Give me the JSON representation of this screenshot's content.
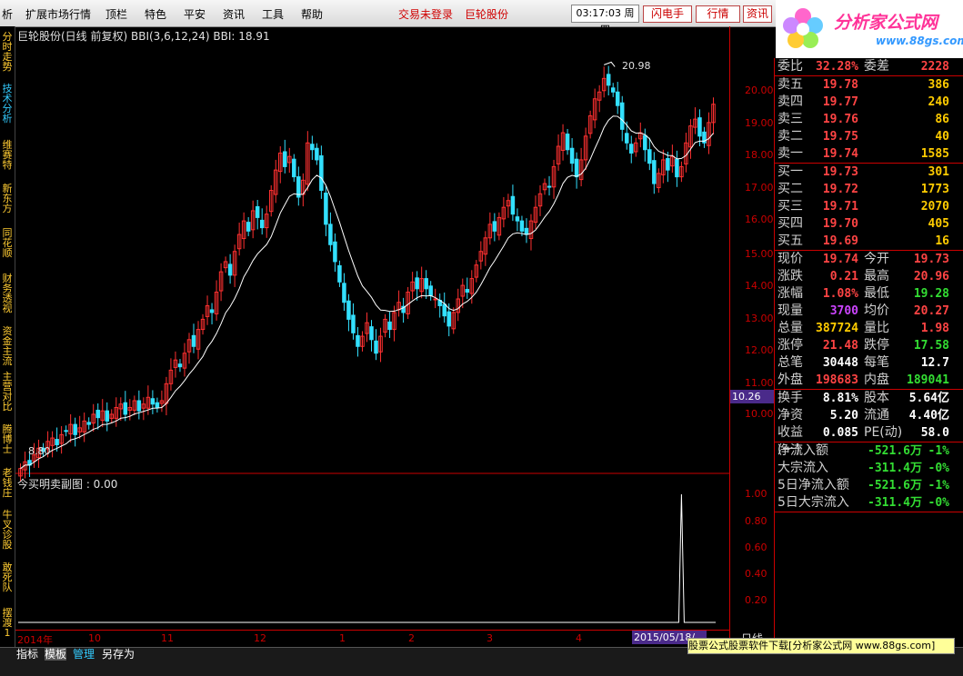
{
  "menu": {
    "items": [
      "析",
      "扩展市场行情",
      "顶栏",
      "特色",
      "平安",
      "资讯",
      "工具",
      "帮助"
    ],
    "login": "交易未登录",
    "stock": "巨轮股份",
    "clock": "03:17:03",
    "weekday": "周四",
    "buttons": [
      "闪电手",
      "行情",
      "资讯"
    ]
  },
  "logo": {
    "title": "分析家公式网",
    "url": "www.88gs.com"
  },
  "left_tabs": [
    "分时走势",
    "技术分析",
    "维赛特",
    "新东方",
    "同花顺",
    "财务透视",
    "资金主流",
    "主营对比",
    "腾博士",
    "老钱庄",
    "牛叉诊股",
    "敢死队",
    "摆渡1"
  ],
  "main_chart": {
    "header": "巨轮股份(日线 前复权) BBI(3,6,12,24) BBI: 18.91",
    "high_label": "20.98",
    "low_label": "8.80",
    "price_tag": "10.26"
  },
  "sub_chart": {
    "header": "今买明卖副图 : 0.00"
  },
  "y_ticks_main": [
    "20.00",
    "19.00",
    "18.00",
    "17.00",
    "16.00",
    "15.00",
    "14.00",
    "13.00",
    "12.00",
    "11.00",
    "10.00"
  ],
  "y_ticks_sub": [
    "1.00",
    "0.80",
    "0.60",
    "0.40",
    "0.20"
  ],
  "months": [
    "2014年",
    "10",
    "11",
    "12",
    "1",
    "2",
    "3",
    "4"
  ],
  "cursor_date": "2015/05/18/",
  "axis_label": "日线",
  "quote": {
    "wei": [
      [
        "委比",
        "32.28%"
      ],
      [
        "委差",
        "2228"
      ]
    ],
    "sell": [
      [
        "卖五",
        "19.78",
        "386"
      ],
      [
        "卖四",
        "19.77",
        "240"
      ],
      [
        "卖三",
        "19.76",
        "86"
      ],
      [
        "卖二",
        "19.75",
        "40"
      ],
      [
        "卖一",
        "19.74",
        "1585"
      ]
    ],
    "buy": [
      [
        "买一",
        "19.73",
        "301"
      ],
      [
        "买二",
        "19.72",
        "1773"
      ],
      [
        "买三",
        "19.71",
        "2070"
      ],
      [
        "买四",
        "19.70",
        "405"
      ],
      [
        "买五",
        "19.69",
        "16"
      ]
    ],
    "stats": [
      [
        "现价",
        "19.74",
        "今开",
        "19.73"
      ],
      [
        "涨跌",
        "0.21",
        "最高",
        "20.96"
      ],
      [
        "涨幅",
        "1.08%",
        "最低",
        "19.28"
      ],
      [
        "现量",
        "3700",
        "均价",
        "20.27"
      ],
      [
        "总量",
        "387724",
        "量比",
        "1.98"
      ],
      [
        "涨停",
        "21.48",
        "跌停",
        "17.58"
      ],
      [
        "总笔",
        "30448",
        "每笔",
        "12.7"
      ],
      [
        "外盘",
        "198683",
        "内盘",
        "189041"
      ]
    ],
    "cap": [
      [
        "换手",
        "8.81%",
        "股本",
        "5.64亿"
      ],
      [
        "净资",
        "5.20",
        "流通",
        "4.40亿"
      ],
      [
        "收益(一)",
        "0.085",
        "PE(动)",
        "58.0"
      ]
    ],
    "flow": [
      [
        "净流入额",
        "-521.6万",
        "-1%"
      ],
      [
        "大宗流入",
        "-311.4万",
        "-0%"
      ],
      [
        "5日净流入额",
        "-521.6万",
        "-1%"
      ],
      [
        "5日大宗流入",
        "-311.4万",
        "-0%"
      ]
    ]
  },
  "bottom_tabs": [
    "指标",
    "模板",
    "管理",
    "另存为"
  ],
  "ad_text": "股票公式股票软件下载[分析家公式网 www.88gs.com]",
  "chart_data": {
    "type": "candlestick",
    "ylim": [
      9.5,
      21.5
    ],
    "closes": [
      9.0,
      9.2,
      9.1,
      9.4,
      9.6,
      9.5,
      9.8,
      9.9,
      9.7,
      10.0,
      10.1,
      10.3,
      10.0,
      10.2,
      10.4,
      10.3,
      10.6,
      10.5,
      10.7,
      10.4,
      10.6,
      10.8,
      10.9,
      10.6,
      10.8,
      11.0,
      10.7,
      10.9,
      11.1,
      10.9,
      10.8,
      11.0,
      11.5,
      11.9,
      12.2,
      12.0,
      12.4,
      12.8,
      12.6,
      13.1,
      13.4,
      13.8,
      13.6,
      14.2,
      14.8,
      15.1,
      14.7,
      15.4,
      15.9,
      16.3,
      16.0,
      16.6,
      16.4,
      16.1,
      16.5,
      17.2,
      17.8,
      18.3,
      17.9,
      18.2,
      17.6,
      17.0,
      17.5,
      18.6,
      18.4,
      18.1,
      17.2,
      16.2,
      15.6,
      15.1,
      14.5,
      13.9,
      13.4,
      13.0,
      12.6,
      12.9,
      13.3,
      12.8,
      12.4,
      12.9,
      13.4,
      13.1,
      13.6,
      13.9,
      13.6,
      14.2,
      14.5,
      14.3,
      14.6,
      14.3,
      14.1,
      14.0,
      13.8,
      13.5,
      13.2,
      13.6,
      14.0,
      14.4,
      14.2,
      14.6,
      15.0,
      15.4,
      15.8,
      16.2,
      16.0,
      16.4,
      16.7,
      16.9,
      16.5,
      16.3,
      16.0,
      15.9,
      16.3,
      16.7,
      17.1,
      17.4,
      17.3,
      17.9,
      18.5,
      18.9,
      18.4,
      18.0,
      17.6,
      18.1,
      18.8,
      19.4,
      19.9,
      20.1,
      20.5,
      20.3,
      20.1,
      19.7,
      19.0,
      18.6,
      18.3,
      18.6,
      18.9,
      18.4,
      18.0,
      17.4,
      17.7,
      18.1,
      17.8,
      18.2,
      17.6,
      17.9,
      18.6,
      19.1,
      19.3,
      18.8,
      18.6,
      19.2,
      19.74
    ],
    "sub_signal_index": 145
  }
}
